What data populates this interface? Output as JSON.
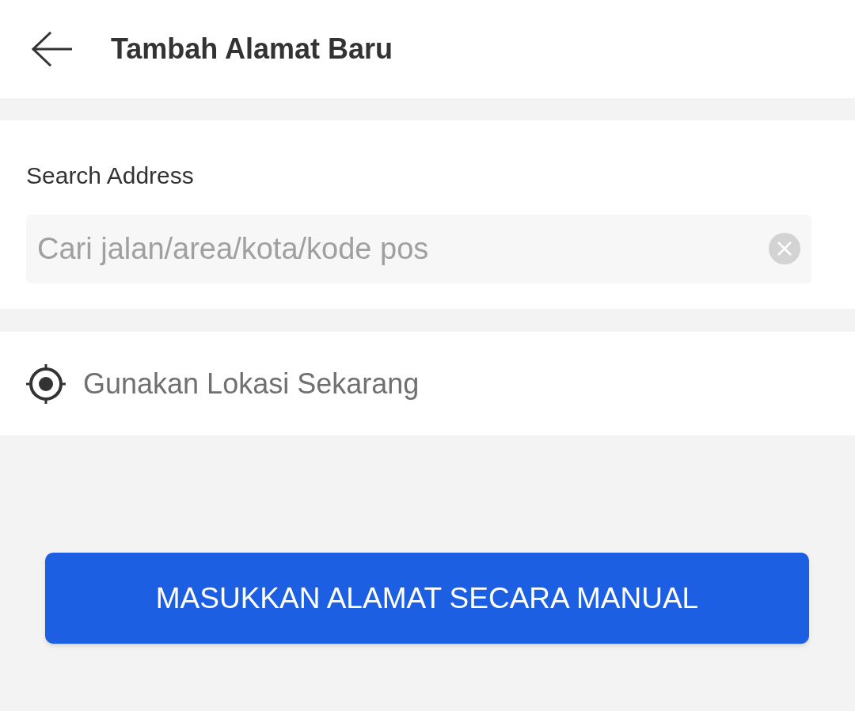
{
  "header": {
    "title": "Tambah Alamat Baru"
  },
  "search": {
    "label": "Search Address",
    "placeholder": "Cari jalan/area/kota/kode pos"
  },
  "location_option": {
    "label": "Gunakan Lokasi Sekarang"
  },
  "manual_button": {
    "label": "MASUKKAN ALAMAT SECARA MANUAL"
  }
}
